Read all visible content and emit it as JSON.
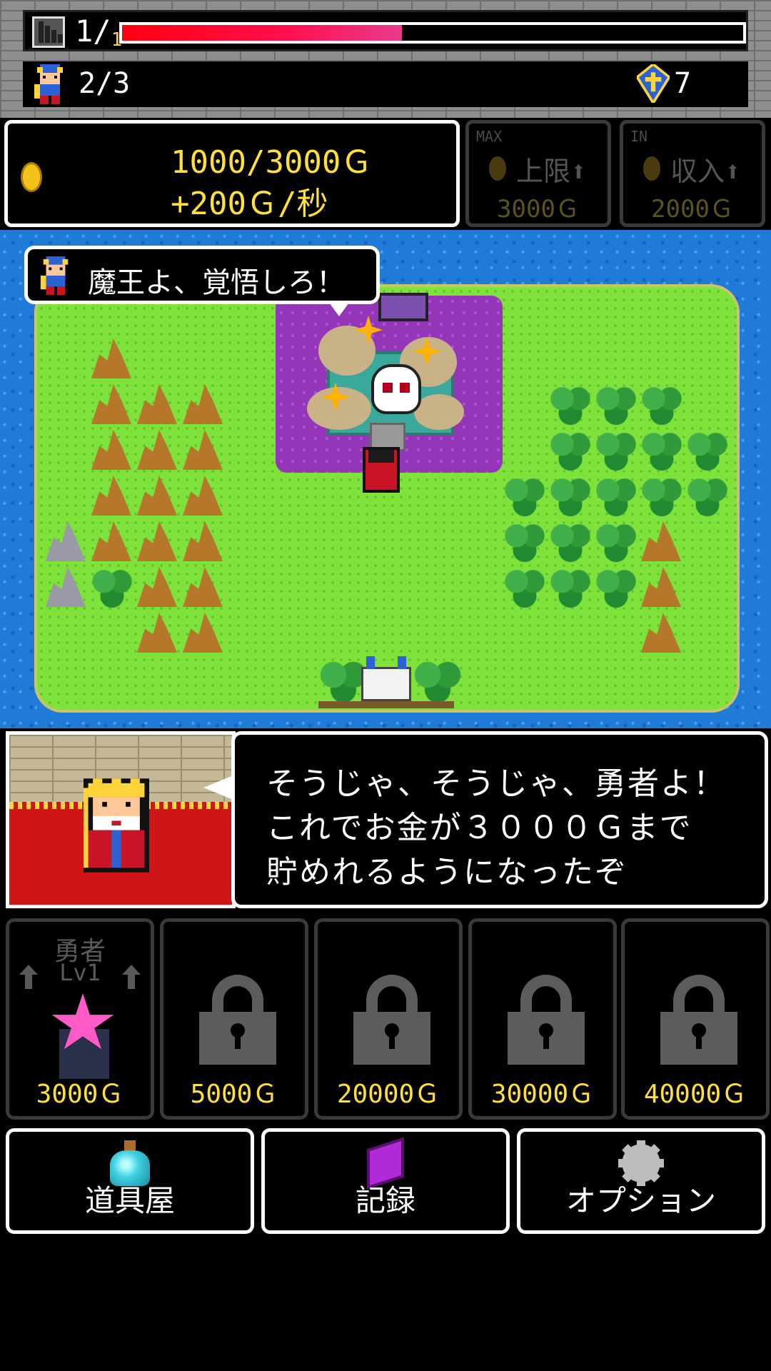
{
  "hud": {
    "floor_current": "1/",
    "floor_total": "1",
    "hp_percent": 0.45,
    "party": "2/3",
    "gems": "7"
  },
  "gold": {
    "amount": "1000/3000Ｇ",
    "rate": "+200Ｇ/秒"
  },
  "upgrades": [
    {
      "tag": "MAX",
      "label": "上限⬆",
      "cost": "3000Ｇ"
    },
    {
      "tag": "IN",
      "label": "収入⬆",
      "cost": "2000Ｇ"
    }
  ],
  "map": {
    "hero_speech": "魔王よ、覚悟しろ！"
  },
  "dialog": {
    "lines": [
      "そうじゃ、そうじゃ、勇者よ！",
      "これでお金が３０００Ｇまで",
      "貯めれるようになったぞ"
    ]
  },
  "slots": [
    {
      "name": "勇者",
      "level": "Lv1",
      "cost": "3000Ｇ",
      "locked": false
    },
    {
      "cost": "5000Ｇ",
      "locked": true
    },
    {
      "cost": "20000Ｇ",
      "locked": true
    },
    {
      "cost": "30000Ｇ",
      "locked": true
    },
    {
      "cost": "40000Ｇ",
      "locked": true
    }
  ],
  "menu": [
    {
      "label": "道具屋",
      "icon": "potion-icon"
    },
    {
      "label": "記録",
      "icon": "book-icon"
    },
    {
      "label": "オプション",
      "icon": "gear-icon"
    }
  ],
  "colors": {
    "gold_text": "#ffe033",
    "hp_bar": "#ff0010",
    "water": "#1f7ad8",
    "grass": "#7ee23a",
    "swamp": "#9436b8"
  }
}
